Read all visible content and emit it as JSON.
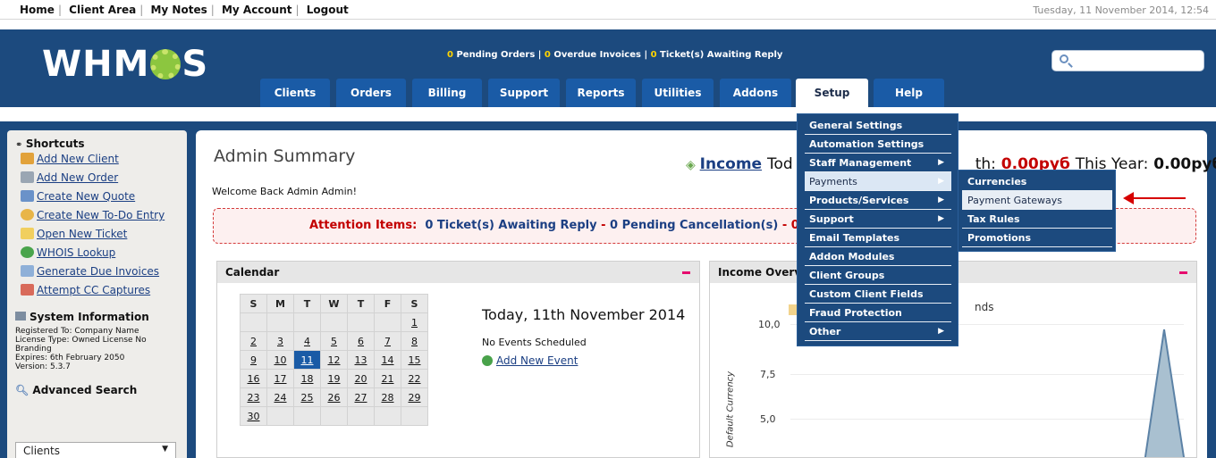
{
  "topbar": {
    "links": [
      "Home",
      "Client Area",
      "My Notes",
      "My Account",
      "Logout"
    ],
    "datetime": "Tuesday, 11 November 2014, 12:54"
  },
  "header": {
    "logo_text_left": "WHM",
    "logo_text_right": "S",
    "stats": {
      "pending_orders_count": "0",
      "pending_orders_label": "Pending Orders",
      "overdue_count": "0",
      "overdue_label": "Overdue Invoices",
      "tickets_count": "0",
      "tickets_label": "Ticket(s) Awaiting Reply"
    },
    "search_placeholder": ""
  },
  "nav": {
    "tabs": [
      "Clients",
      "Orders",
      "Billing",
      "Support",
      "Reports",
      "Utilities",
      "Addons",
      "Setup",
      "Help"
    ],
    "active": "Setup"
  },
  "setup_menu": {
    "items": [
      "General Settings",
      "Automation Settings",
      "Staff Management",
      "Payments",
      "Products/Services",
      "Support",
      "Email Templates",
      "Addon Modules",
      "Client Groups",
      "Custom Client Fields",
      "Fraud Protection",
      "Other"
    ],
    "highlighted": "Payments",
    "submenu": [
      "Currencies",
      "Payment Gateways",
      "Tax Rules",
      "Promotions"
    ],
    "submenu_highlighted": "Payment Gateways"
  },
  "sidebar": {
    "shortcuts_title": "Shortcuts",
    "shortcuts": [
      "Add New Client",
      "Add New Order",
      "Create New Quote",
      "Create New To-Do Entry",
      "Open New Ticket",
      "WHOIS Lookup",
      "Generate Due Invoices",
      "Attempt CC Captures"
    ],
    "sysinfo_title": "System Information",
    "sysinfo_lines": [
      "Registered To: Company Name",
      "License Type: Owned License No",
      "Branding",
      "Expires: 6th February 2050",
      "Version: 5.3.7"
    ],
    "advsearch_title": "Advanced Search",
    "advsearch_select": "Clients"
  },
  "main": {
    "title": "Admin Summary",
    "welcome": "Welcome Back Admin Admin!",
    "income_link": "Income",
    "income_today_label": "Tod",
    "income_month_label": "th:",
    "income_month_value": "0.00руб",
    "income_year_label": "This Year:",
    "income_year_value": "0.00руб",
    "attention_label": "Attention Items:",
    "attention_tickets": "0 Ticket(s) Awaiting Reply",
    "attention_sep": "-",
    "attention_cancellations": "0 Pending Cancellation(s)",
    "attention_tail": "- 0"
  },
  "calendar": {
    "title": "Calendar",
    "days": [
      "S",
      "M",
      "T",
      "W",
      "T",
      "F",
      "S"
    ],
    "weeks": [
      [
        "",
        "",
        "",
        "",
        "",
        "",
        "1"
      ],
      [
        "2",
        "3",
        "4",
        "5",
        "6",
        "7",
        "8"
      ],
      [
        "9",
        "10",
        "11",
        "12",
        "13",
        "14",
        "15"
      ],
      [
        "16",
        "17",
        "18",
        "19",
        "20",
        "21",
        "22"
      ],
      [
        "23",
        "24",
        "25",
        "26",
        "27",
        "28",
        "29"
      ],
      [
        "30",
        "",
        "",
        "",
        "",
        "",
        ""
      ]
    ],
    "today_day": "11",
    "today_heading": "Today, 11th November 2014",
    "no_events": "No Events Scheduled",
    "add_event": "Add New Event"
  },
  "income_overview": {
    "title": "Income Overvi",
    "legend_fragment": "nds",
    "y_axis_label": "Default Currency",
    "y_ticks": [
      "10,0",
      "7,5",
      "5,0"
    ]
  }
}
